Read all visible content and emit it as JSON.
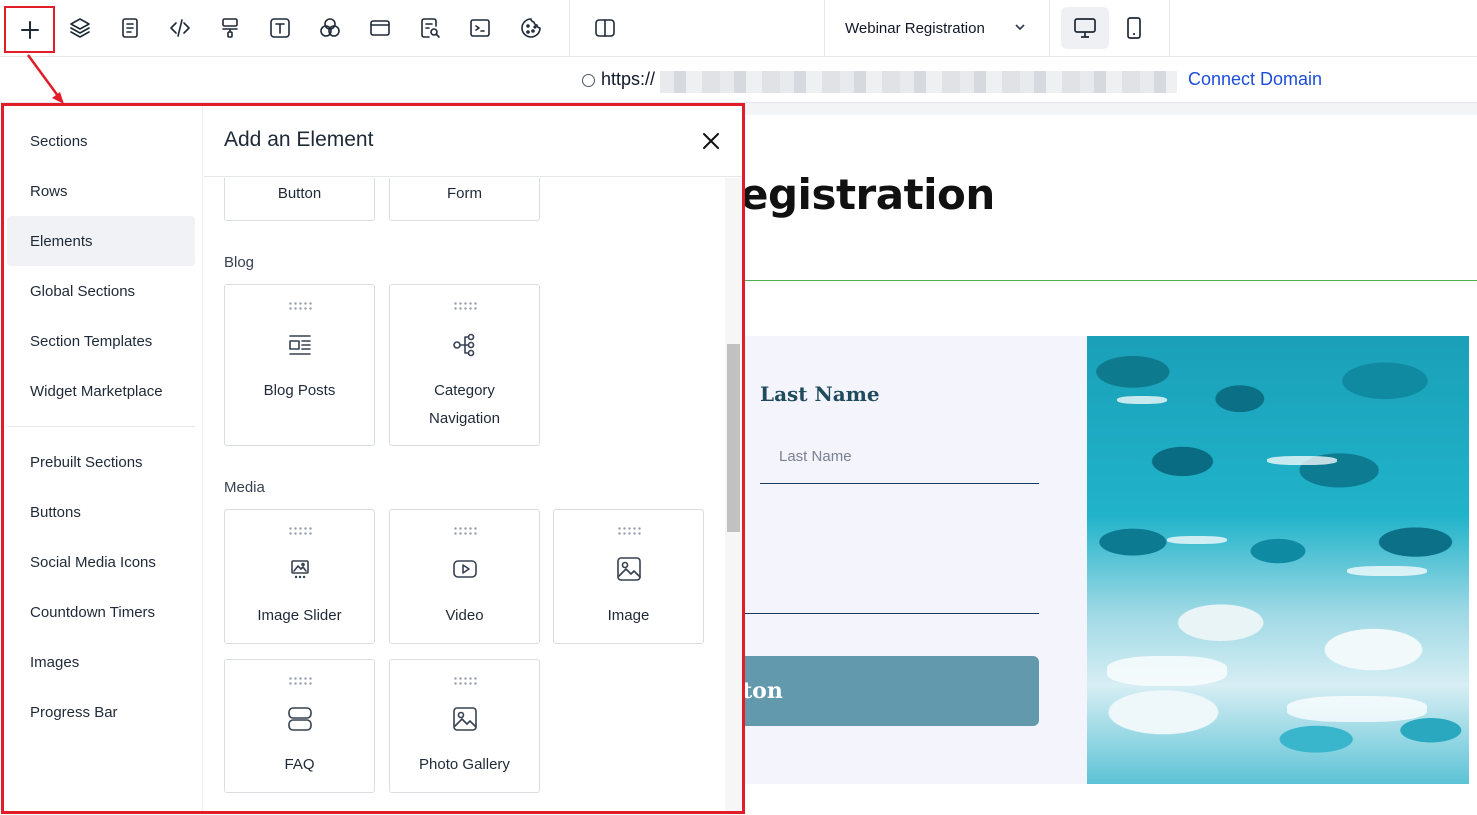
{
  "toolbar": {
    "tools": [
      {
        "name": "add-element",
        "icon": "plus-icon"
      },
      {
        "name": "layers",
        "icon": "layers-icon"
      },
      {
        "name": "pages",
        "icon": "document-icon"
      },
      {
        "name": "code",
        "icon": "code-icon"
      },
      {
        "name": "styles",
        "icon": "paint-roller-icon"
      },
      {
        "name": "typography",
        "icon": "text-icon"
      },
      {
        "name": "colors",
        "icon": "color-circles-icon"
      },
      {
        "name": "popup",
        "icon": "window-icon"
      },
      {
        "name": "seo",
        "icon": "file-search-icon"
      },
      {
        "name": "tracking-code",
        "icon": "terminal-icon"
      },
      {
        "name": "cookie",
        "icon": "cookie-icon"
      },
      {
        "name": "split-view",
        "icon": "columns-icon"
      }
    ],
    "page_select": "Webinar Registration",
    "devices": [
      {
        "name": "desktop",
        "icon": "monitor-icon",
        "active": true
      },
      {
        "name": "mobile",
        "icon": "phone-icon",
        "active": false
      }
    ]
  },
  "urlbar": {
    "prefix": "https://",
    "connect_label": "Connect Domain"
  },
  "canvas": {
    "heading": "egistration",
    "field_label": "Last Name",
    "field_placeholder": "Last Name",
    "button_label": "ton"
  },
  "panel": {
    "title": "Add an Element",
    "sidebar": [
      {
        "label": "Sections",
        "active": false
      },
      {
        "label": "Rows",
        "active": false
      },
      {
        "label": "Elements",
        "active": true
      },
      {
        "label": "Global Sections",
        "active": false
      },
      {
        "label": "Section Templates",
        "active": false
      },
      {
        "label": "Widget Marketplace",
        "active": false
      },
      {
        "label": "Prebuilt Sections",
        "active": false
      },
      {
        "label": "Buttons",
        "active": false
      },
      {
        "label": "Social Media Icons",
        "active": false
      },
      {
        "label": "Countdown Timers",
        "active": false
      },
      {
        "label": "Images",
        "active": false
      },
      {
        "label": "Progress Bar",
        "active": false
      }
    ],
    "top_cards": [
      {
        "label": "Button"
      },
      {
        "label": "Form"
      }
    ],
    "groups": [
      {
        "label": "Blog",
        "cards": [
          {
            "label": "Blog Posts",
            "icon": "blog-posts-icon"
          },
          {
            "label": "Category Navigation",
            "icon": "category-tree-icon"
          }
        ]
      },
      {
        "label": "Media",
        "cards": [
          {
            "label": "Image Slider",
            "icon": "image-slider-icon"
          },
          {
            "label": "Video",
            "icon": "video-play-icon"
          },
          {
            "label": "Image",
            "icon": "image-icon"
          },
          {
            "label": "FAQ",
            "icon": "faq-stack-icon"
          },
          {
            "label": "Photo Gallery",
            "icon": "photo-gallery-icon"
          }
        ]
      }
    ]
  },
  "colors": {
    "highlight": "#e11d2a",
    "link": "#1d4ed8",
    "form_button": "#6399ad",
    "form_label": "#1f4b5c"
  }
}
